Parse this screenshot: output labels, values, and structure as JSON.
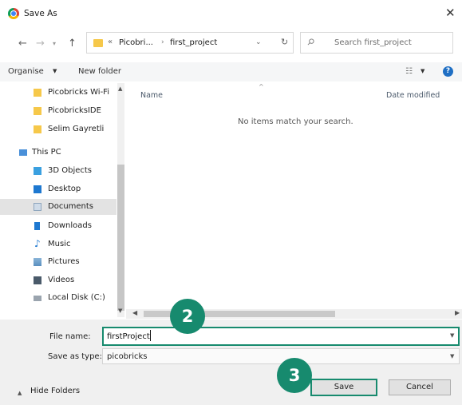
{
  "window": {
    "title": "Save As",
    "close_glyph": "✕"
  },
  "nav_buttons": {
    "back": "←",
    "forward": "→",
    "recent": "▾",
    "up": "↑"
  },
  "address_bar": {
    "prefix": "«",
    "crumbs": [
      "Picobri...",
      "first_project"
    ],
    "separator": "›",
    "dropdown": "⌄",
    "refresh": "↻"
  },
  "search": {
    "placeholder": "Search first_project"
  },
  "toolbar": {
    "organise_label": "Organise",
    "new_folder_label": "New folder",
    "view_glyph": "☷",
    "help_glyph": "?"
  },
  "nav_pane": {
    "items": [
      {
        "label": "Picobricks Wi-Fi",
        "icon": "folder-icon"
      },
      {
        "label": "PicobricksIDE",
        "icon": "folder-icon"
      },
      {
        "label": "Selim Gayretli",
        "icon": "folder-icon"
      },
      {
        "label": "This PC",
        "icon": "computer-icon"
      },
      {
        "label": "3D Objects",
        "icon": "cube-icon"
      },
      {
        "label": "Desktop",
        "icon": "desktop-icon"
      },
      {
        "label": "Documents",
        "icon": "document-icon",
        "selected": true
      },
      {
        "label": "Downloads",
        "icon": "download-icon"
      },
      {
        "label": "Music",
        "icon": "music-icon"
      },
      {
        "label": "Pictures",
        "icon": "pictures-icon"
      },
      {
        "label": "Videos",
        "icon": "videos-icon"
      },
      {
        "label": "Local Disk (C:)",
        "icon": "disk-icon"
      }
    ]
  },
  "content": {
    "columns": [
      "Name",
      "Date modified"
    ],
    "empty_message": "No items match your search."
  },
  "form": {
    "file_name_label": "File name:",
    "file_name_value": "firstProject",
    "save_type_label": "Save as type:",
    "save_type_value": "picobricks"
  },
  "footer": {
    "hide_folders_label": "Hide Folders",
    "save_label": "Save",
    "cancel_label": "Cancel"
  },
  "steps": {
    "step2": "2",
    "step3": "3",
    "accent_color": "#178a6e"
  }
}
